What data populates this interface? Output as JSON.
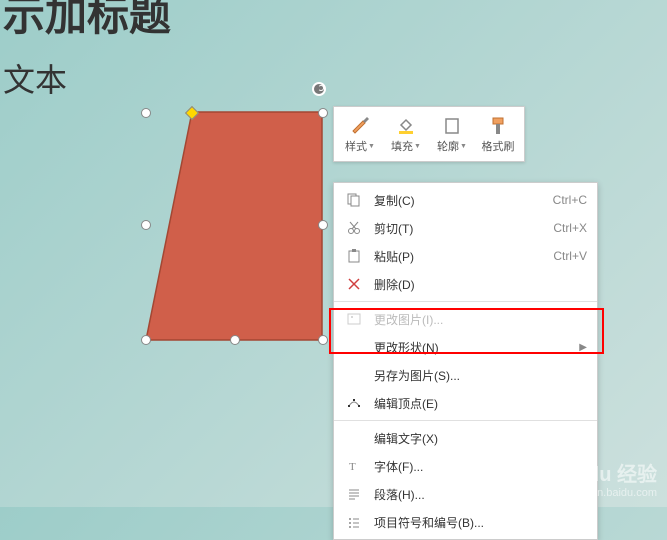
{
  "header": {
    "partial_title": "示加标题",
    "subtitle": "文本"
  },
  "toolbar": {
    "style": "样式",
    "fill": "填充",
    "outline": "轮廓",
    "format_painter": "格式刷"
  },
  "menu": {
    "copy": {
      "label": "复制(C)",
      "shortcut": "Ctrl+C"
    },
    "cut": {
      "label": "剪切(T)",
      "shortcut": "Ctrl+X"
    },
    "paste": {
      "label": "粘贴(P)",
      "shortcut": "Ctrl+V"
    },
    "delete": {
      "label": "删除(D)"
    },
    "change_image": {
      "label": "更改图片(I)..."
    },
    "change_shape": {
      "label": "更改形状(N)"
    },
    "save_as_image": {
      "label": "另存为图片(S)..."
    },
    "edit_vertices": {
      "label": "编辑顶点(E)"
    },
    "edit_text": {
      "label": "编辑文字(X)"
    },
    "font": {
      "label": "字体(F)..."
    },
    "paragraph": {
      "label": "段落(H)..."
    },
    "bullets": {
      "label": "项目符号和编号(B)..."
    }
  },
  "watermark": {
    "logo": "Baidu 经验",
    "url": "jingyan.baidu.com"
  }
}
